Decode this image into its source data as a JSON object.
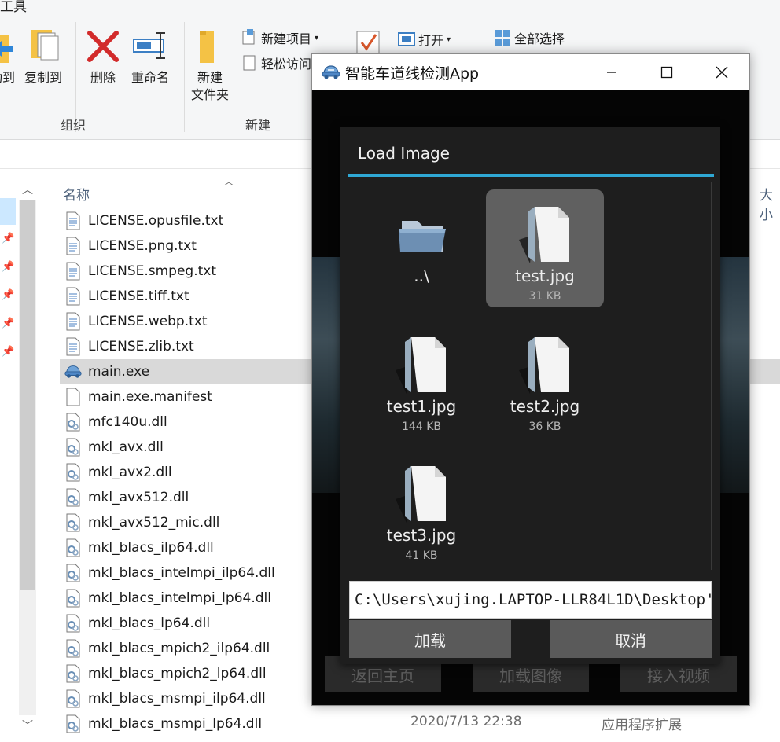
{
  "explorer": {
    "ribbon": {
      "tab_partial": "工具",
      "buttons": {
        "move_to": "动到",
        "copy_to": "复制到",
        "delete": "删除",
        "rename": "重命名",
        "new_folder": "新建\n文件夹",
        "new_item": "新建项目",
        "easy_access": "轻松访问",
        "open": "打开",
        "select_all": "全部选择"
      },
      "groups": {
        "organize": "组织",
        "new": "新建"
      }
    },
    "columns": {
      "name": "名称",
      "size_partial": "大小"
    },
    "files": [
      {
        "name": "LICENSE.opusfile.txt",
        "type": "txt"
      },
      {
        "name": "LICENSE.png.txt",
        "type": "txt"
      },
      {
        "name": "LICENSE.smpeg.txt",
        "type": "txt"
      },
      {
        "name": "LICENSE.tiff.txt",
        "type": "txt"
      },
      {
        "name": "LICENSE.webp.txt",
        "type": "txt"
      },
      {
        "name": "LICENSE.zlib.txt",
        "type": "txt"
      },
      {
        "name": "main.exe",
        "type": "exe",
        "selected": true
      },
      {
        "name": "main.exe.manifest",
        "type": "file"
      },
      {
        "name": "mfc140u.dll",
        "type": "dll"
      },
      {
        "name": "mkl_avx.dll",
        "type": "dll"
      },
      {
        "name": "mkl_avx2.dll",
        "type": "dll"
      },
      {
        "name": "mkl_avx512.dll",
        "type": "dll"
      },
      {
        "name": "mkl_avx512_mic.dll",
        "type": "dll"
      },
      {
        "name": "mkl_blacs_ilp64.dll",
        "type": "dll"
      },
      {
        "name": "mkl_blacs_intelmpi_ilp64.dll",
        "type": "dll"
      },
      {
        "name": "mkl_blacs_intelmpi_lp64.dll",
        "type": "dll"
      },
      {
        "name": "mkl_blacs_lp64.dll",
        "type": "dll"
      },
      {
        "name": "mkl_blacs_mpich2_ilp64.dll",
        "type": "dll"
      },
      {
        "name": "mkl_blacs_mpich2_lp64.dll",
        "type": "dll"
      },
      {
        "name": "mkl_blacs_msmpi_ilp64.dll",
        "type": "dll"
      },
      {
        "name": "mkl_blacs_msmpi_lp64.dll",
        "type": "dll"
      }
    ],
    "last_row": {
      "date": "2020/7/13 22:38",
      "type": "应用程序扩展"
    }
  },
  "app": {
    "title": "智能车道线检测App",
    "background_buttons": {
      "home": "返回主页",
      "load_image": "加载图像",
      "video": "接入视频"
    },
    "dialog": {
      "title": "Load Image",
      "files": [
        {
          "name": "..\\",
          "size": "",
          "kind": "folder"
        },
        {
          "name": "test.jpg",
          "size": "31 KB",
          "kind": "file",
          "selected": true
        },
        {
          "name": "test1.jpg",
          "size": "144 KB",
          "kind": "file"
        },
        {
          "name": "test2.jpg",
          "size": "36 KB",
          "kind": "file"
        },
        {
          "name": "test3.jpg",
          "size": "41 KB",
          "kind": "file"
        }
      ],
      "path": "C:\\Users\\xujing.LAPTOP-LLR84L1D\\Desktop'",
      "load_button": "加载",
      "cancel_button": "取消"
    }
  },
  "colors": {
    "accent_line": "#2fa8d4",
    "selected_row": "#d9d9d9",
    "selected_tile": "#606060",
    "dialog_bg": "#1e1e1e"
  }
}
